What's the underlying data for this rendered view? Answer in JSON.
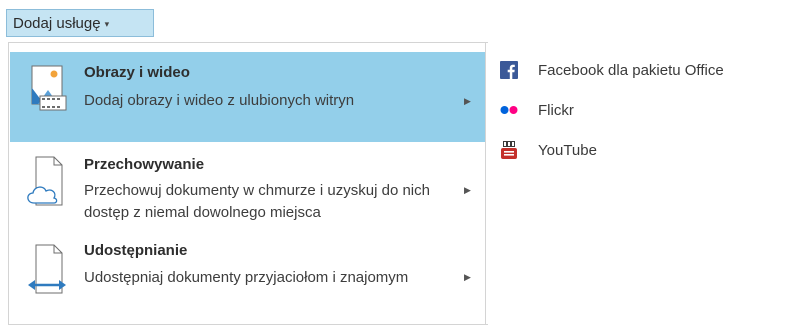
{
  "toolbar": {
    "add_service_label": "Dodaj usługę",
    "caret_glyph": "▾"
  },
  "menu": {
    "items": [
      {
        "title": "Obrazy i wideo",
        "description": "Dodaj obrazy i wideo z ulubionych witryn",
        "icon": "image-video-icon",
        "selected": true
      },
      {
        "title": "Przechowywanie",
        "description": "Przechowuj dokumenty w chmurze i uzyskuj do nich dostęp z niemal dowolnego miejsca",
        "icon": "cloud-document-icon",
        "selected": false
      },
      {
        "title": "Udostępnianie",
        "description": "Udostępniaj dokumenty przyjaciołom i znajomym",
        "icon": "share-document-icon",
        "selected": false
      }
    ],
    "arrow_glyph": "▶"
  },
  "submenu": {
    "items": [
      {
        "label": "Facebook dla pakietu Office",
        "icon": "facebook-icon"
      },
      {
        "label": "Flickr",
        "icon": "flickr-icon"
      },
      {
        "label": "YouTube",
        "icon": "youtube-icon"
      }
    ]
  },
  "colors": {
    "selected_bg": "#93cfea",
    "button_bg": "#c5e4f3",
    "facebook": "#3b5998",
    "flickr_blue": "#0063dc",
    "flickr_pink": "#ff0084",
    "youtube": "#c4302b"
  }
}
